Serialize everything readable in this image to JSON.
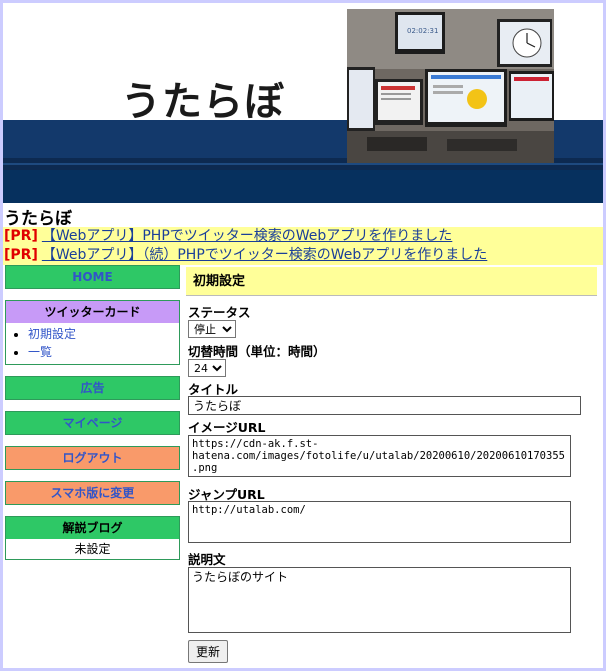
{
  "banner": {
    "logo_text": "うたらぼ",
    "photo_clock": "02:02:31"
  },
  "site_title": "うたらぼ",
  "pr_links": [
    {
      "tag": "[PR]",
      "text": "【Webアプリ】PHPでツイッター検索のWebアプリを作りました"
    },
    {
      "tag": "[PR]",
      "text": "【Webアプリ】（続）PHPでツイッター検索のWebアプリを作りました"
    }
  ],
  "nav": {
    "home": "HOME",
    "twitter_card": {
      "title": "ツイッターカード",
      "items": [
        "初期設定",
        "一覧"
      ]
    },
    "ads": "広告",
    "mypage": "マイページ",
    "logout": "ログアウト",
    "mobile": "スマホ版に変更",
    "blog": {
      "title": "解説ブログ",
      "value": "未設定"
    }
  },
  "main": {
    "heading": "初期設定",
    "status": {
      "label": "ステータス",
      "value": "停止"
    },
    "interval": {
      "label": "切替時間（単位：時間）",
      "value": "24"
    },
    "title": {
      "label": "タイトル",
      "value": "うたらぼ"
    },
    "image_url": {
      "label": "イメージURL",
      "value": "https://cdn-ak.f.st-hatena.com/images/fotolife/u/utalab/20200610/20200610170355.png"
    },
    "jump_url": {
      "label": "ジャンプURL",
      "value": "http://utalab.com/"
    },
    "description": {
      "label": "説明文",
      "value": "うたらぼのサイト"
    },
    "submit": "更新"
  },
  "colors": {
    "page_bg": "#ccccff",
    "banner_navy": "#13396b",
    "pr_bg": "#ffff99",
    "nav_green": "#2ec866",
    "nav_orange": "#f99a6a",
    "nav_purple": "#c79af7",
    "link_blue": "#3255c8"
  }
}
